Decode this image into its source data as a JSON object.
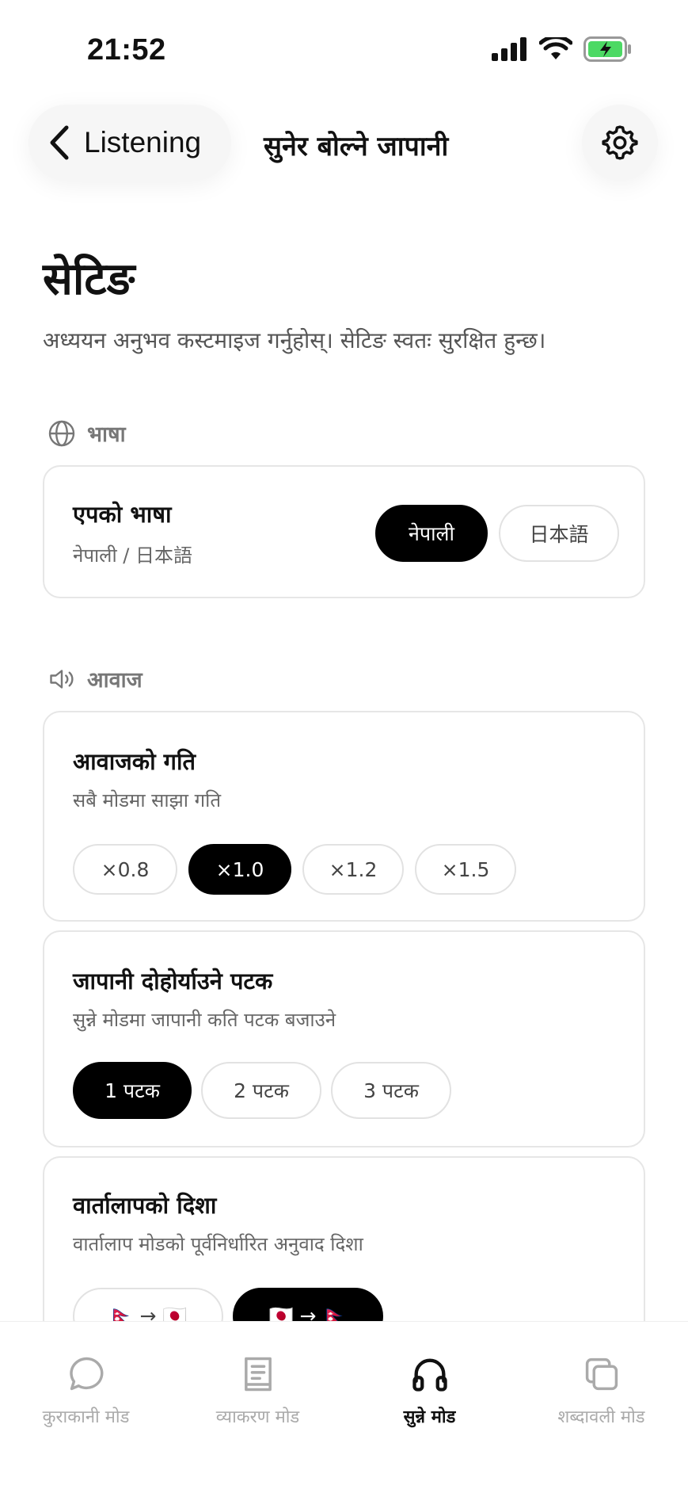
{
  "status_bar": {
    "time": "21:52"
  },
  "header": {
    "back_label": "Listening",
    "title": "सुनेर बोल्ने जापानी"
  },
  "page": {
    "title": "सेटिङ",
    "description": "अध्ययन अनुभव कस्टमाइज गर्नुहोस्। सेटिङ स्वतः सुरक्षित हुन्छ।"
  },
  "language_section": {
    "heading": "भाषा",
    "card": {
      "title": "एपको भाषा",
      "subtitle": "नेपाली / 日本語",
      "options": [
        "नेपाली",
        "日本語"
      ],
      "selected": "नेपाली"
    }
  },
  "voice_section": {
    "heading": "आवाज",
    "speed": {
      "title": "आवाजको गति",
      "subtitle": "सबै मोडमा साझा गति",
      "options": [
        "×0.8",
        "×1.0",
        "×1.2",
        "×1.5"
      ],
      "selected": "×1.0"
    },
    "repeat": {
      "title": "जापानी दोहोर्याउने पटक",
      "subtitle": "सुन्ने मोडमा जापानी कति पटक बजाउने",
      "options": [
        "1 पटक",
        "2 पटक",
        "3 पटक"
      ],
      "selected": "1 पटक"
    },
    "direction": {
      "title": "वार्तालापको दिशा",
      "subtitle": "वार्तालाप मोडको पूर्वनिर्धारित अनुवाद दिशा",
      "options": [
        "🇳🇵 → 🇯🇵",
        "🇯🇵 → 🇳🇵"
      ],
      "selected": "🇯🇵 → 🇳🇵"
    }
  },
  "tab_bar": {
    "tabs": [
      {
        "label": "कुराकानी मोड",
        "icon": "chat-bubble-icon",
        "active": false
      },
      {
        "label": "व्याकरण मोड",
        "icon": "book-icon",
        "active": false
      },
      {
        "label": "सुन्ने मोड",
        "icon": "headphones-icon",
        "active": true
      },
      {
        "label": "शब्दावली मोड",
        "icon": "cards-icon",
        "active": false
      }
    ]
  }
}
